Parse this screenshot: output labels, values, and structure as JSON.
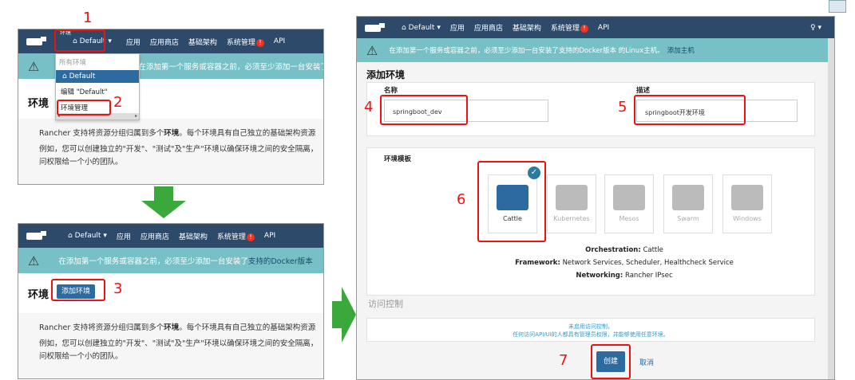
{
  "nav": {
    "env_label": "Default",
    "env_small": "环境",
    "items": [
      "应用",
      "应用商店",
      "基础架构",
      "系统管理",
      "API"
    ],
    "badge": "!"
  },
  "dropdown": {
    "header": "所有环境",
    "env_default": "Default",
    "edit": "编辑 \"Default\"",
    "manage": "环境管理"
  },
  "warning": {
    "text": "在添加第一个服务或容器之前，必须至少添加一台安装了",
    "link": "支持的Docker版本",
    "text_full": "在添加第一个服务或容器之前，必须至少添加一台安装了支持的Docker版本 的Linux主机。",
    "add_host": "添加主机"
  },
  "env_page": {
    "title": "环境",
    "add_button": "添加环境",
    "desc1_a": "Rancher 支持将资源分组归属到多个",
    "desc1_b": "环境",
    "desc1_c": "。每个环境具有自己独立的基础架构资源",
    "desc2": "例如，您可以创建独立的\"开发\"、\"测试\"及\"生产\"环境以确保环境之间的安全隔离，",
    "desc3": "问权限给一个小的团队。"
  },
  "add_env": {
    "title": "添加环境",
    "name_label": "名称",
    "name_value": "springboot_dev",
    "desc_label": "描述",
    "desc_value": "springboot开发环境",
    "template_label": "环境模板",
    "templates": [
      "Cattle",
      "Kubernetes",
      "Mesos",
      "Swarm",
      "Windows"
    ],
    "orch_label": "Orchestration:",
    "orch_value": "Cattle",
    "fw_label": "Framework:",
    "fw_value": "Network Services, Scheduler, Healthcheck Service",
    "net_label": "Networking:",
    "net_value": "Rancher IPsec",
    "access_title": "访问控制",
    "access_line1": "未启用访问控制，",
    "access_line2": "任何访问API/UI的人都具有管理员权限，并能够使用任意环境。",
    "create_button": "创建",
    "cancel_link": "取消"
  },
  "steps": [
    "1",
    "2",
    "3",
    "4",
    "5",
    "6",
    "7"
  ]
}
